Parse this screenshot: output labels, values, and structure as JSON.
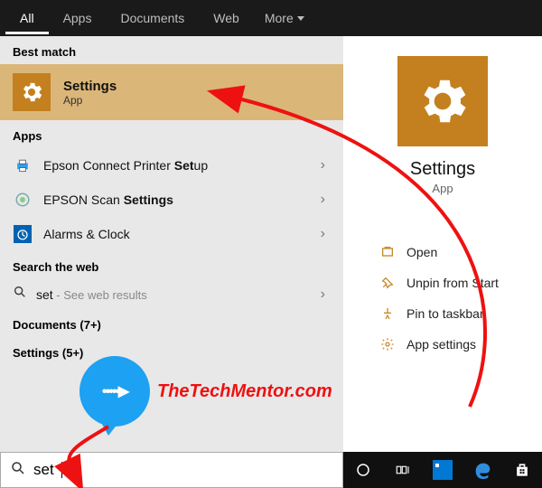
{
  "tabs": {
    "all": "All",
    "apps": "Apps",
    "documents": "Documents",
    "web": "Web",
    "more": "More"
  },
  "labels": {
    "best_match": "Best match",
    "apps": "Apps",
    "search_web": "Search the web",
    "documents": "Documents (7+)",
    "settings_group": "Settings (5+)"
  },
  "best": {
    "title": "Settings",
    "sub": "App"
  },
  "app_rows": [
    {
      "pre": "Epson Connect Printer ",
      "bold": "Set",
      "post": "up"
    },
    {
      "pre": "EPSON Scan ",
      "bold": "Settings",
      "post": ""
    },
    {
      "pre": "Alarms & Clock",
      "bold": "",
      "post": ""
    }
  ],
  "web": {
    "pre": "set",
    "sub": " - See web results"
  },
  "right": {
    "title": "Settings",
    "sub": "App"
  },
  "ctx": {
    "open": "Open",
    "unpin": "Unpin from Start",
    "pin": "Pin to taskbar",
    "appset": "App settings"
  },
  "search": {
    "value": "set"
  },
  "watermark": "TheTechMentor.com"
}
